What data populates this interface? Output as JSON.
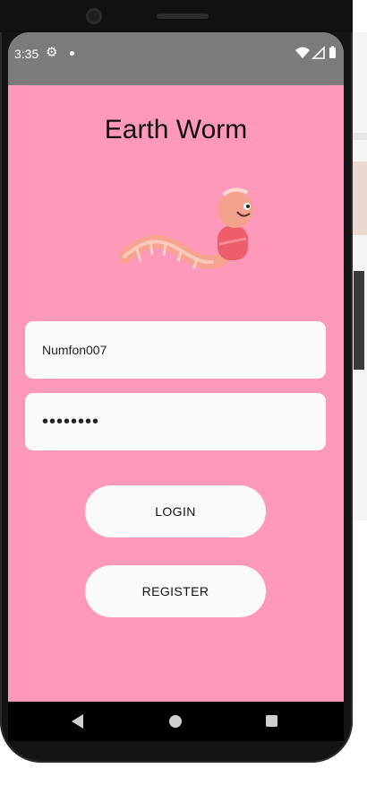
{
  "status_bar": {
    "time": "3:35",
    "gear_icon": "settings-gear",
    "notification_icon": "dot",
    "right_icons": [
      "wifi-icon",
      "signal-icon",
      "battery-icon"
    ]
  },
  "app": {
    "title": "Earth Worm",
    "background_color": "#ff99bb"
  },
  "login_form": {
    "username_value": "Numfon007",
    "password_value": "••••••••",
    "login_label": "LOGIN",
    "register_label": "REGISTER"
  },
  "nav_bar": {
    "back_icon": "back-triangle",
    "home_icon": "home-circle",
    "recents_icon": "recents-square"
  }
}
